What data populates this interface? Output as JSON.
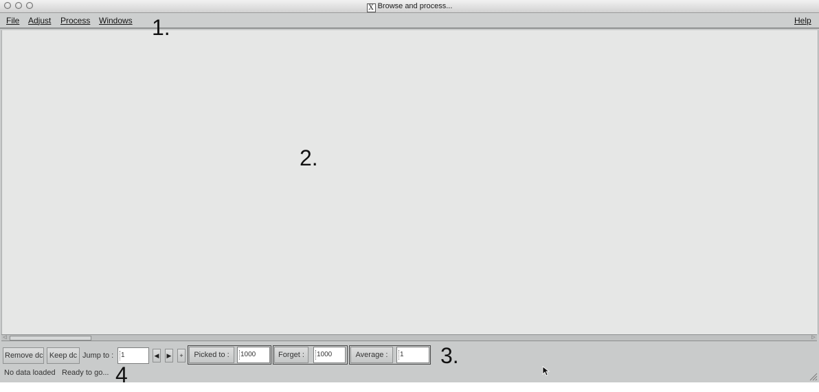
{
  "window": {
    "title": "Browse and process...",
    "title_icon": "X"
  },
  "menu": {
    "file": "File",
    "adjust": "Adjust",
    "process": "Process",
    "windows": "Windows",
    "help": "Help"
  },
  "toolbar": {
    "remove_dc": "Remove dc",
    "keep_dc": "Keep dc",
    "jump_to_label": "Jump to :",
    "jump_to_value": "1",
    "prev_symbol": "◀",
    "next_symbol": "▶",
    "plus_symbol": "+",
    "picked_to_label": "Picked to :",
    "picked_to_value": "1000",
    "forget_label": "Forget :",
    "forget_value": "1000",
    "average_label": "Average :",
    "average_value": "1"
  },
  "status": {
    "data": "No data loaded",
    "state": "Ready to go..."
  },
  "annotations": {
    "one": "1.",
    "two": "2.",
    "three": "3.",
    "four": "4"
  },
  "icons": {
    "title_buttons": [
      "close-icon",
      "minimize-icon",
      "zoom-icon"
    ],
    "scroll_left": "scroll-left-arrow-icon",
    "scroll_right": "scroll-right-arrow-icon",
    "cursor": "mouse-pointer-icon",
    "grip": "resize-grip-icon"
  }
}
